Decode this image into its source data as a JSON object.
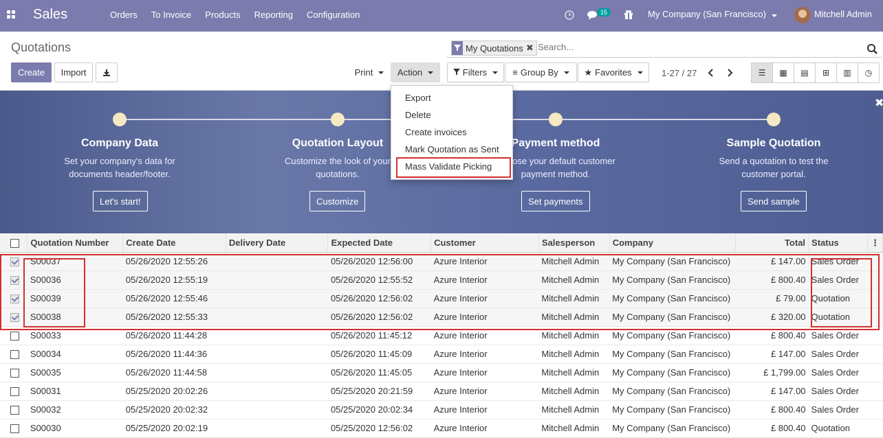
{
  "navbar": {
    "brand": "Sales",
    "menu": [
      "Orders",
      "To Invoice",
      "Products",
      "Reporting",
      "Configuration"
    ],
    "message_count": "15",
    "company": "My Company (San Francisco)",
    "user": "Mitchell Admin"
  },
  "control": {
    "title": "Quotations",
    "create": "Create",
    "import": "Import",
    "print": "Print",
    "action": "Action",
    "filters": "Filters",
    "group_by": "Group By",
    "favorites": "Favorites",
    "pager": "1-27 / 27",
    "facet": "My Quotations",
    "search_placeholder": "Search..."
  },
  "action_menu": [
    "Export",
    "Delete",
    "Create invoices",
    "Mark Quotation as Sent",
    "Mass Validate Picking"
  ],
  "onboarding": [
    {
      "title": "Company Data",
      "desc": "Set your company's data for documents header/footer.",
      "button": "Let's start!"
    },
    {
      "title": "Quotation Layout",
      "desc": "Customize the look of your quotations.",
      "button": "Customize"
    },
    {
      "title": "Payment method",
      "desc": "Choose your default customer payment method.",
      "button": "Set payments"
    },
    {
      "title": "Sample Quotation",
      "desc": "Send a quotation to test the customer portal.",
      "button": "Send sample"
    }
  ],
  "table": {
    "columns": [
      "Quotation Number",
      "Create Date",
      "Delivery Date",
      "Expected Date",
      "Customer",
      "Salesperson",
      "Company",
      "Total",
      "Status"
    ],
    "rows": [
      {
        "num": "S00037",
        "create": "05/26/2020 12:55:26",
        "delivery": "",
        "expected": "05/26/2020 12:56:00",
        "customer": "Azure Interior",
        "sales": "Mitchell Admin",
        "company": "My Company (San Francisco)",
        "total": "£ 147.00",
        "status": "Sales Order",
        "checked": true
      },
      {
        "num": "S00036",
        "create": "05/26/2020 12:55:19",
        "delivery": "",
        "expected": "05/26/2020 12:55:52",
        "customer": "Azure Interior",
        "sales": "Mitchell Admin",
        "company": "My Company (San Francisco)",
        "total": "£ 800.40",
        "status": "Sales Order",
        "checked": true
      },
      {
        "num": "S00039",
        "create": "05/26/2020 12:55:46",
        "delivery": "",
        "expected": "05/26/2020 12:56:02",
        "customer": "Azure Interior",
        "sales": "Mitchell Admin",
        "company": "My Company (San Francisco)",
        "total": "£ 79.00",
        "status": "Quotation",
        "checked": true
      },
      {
        "num": "S00038",
        "create": "05/26/2020 12:55:33",
        "delivery": "",
        "expected": "05/26/2020 12:56:02",
        "customer": "Azure Interior",
        "sales": "Mitchell Admin",
        "company": "My Company (San Francisco)",
        "total": "£ 320.00",
        "status": "Quotation",
        "checked": true
      },
      {
        "num": "S00033",
        "create": "05/26/2020 11:44:28",
        "delivery": "",
        "expected": "05/26/2020 11:45:12",
        "customer": "Azure Interior",
        "sales": "Mitchell Admin",
        "company": "My Company (San Francisco)",
        "total": "£ 800.40",
        "status": "Sales Order",
        "checked": false
      },
      {
        "num": "S00034",
        "create": "05/26/2020 11:44:36",
        "delivery": "",
        "expected": "05/26/2020 11:45:09",
        "customer": "Azure Interior",
        "sales": "Mitchell Admin",
        "company": "My Company (San Francisco)",
        "total": "£ 147.00",
        "status": "Sales Order",
        "checked": false
      },
      {
        "num": "S00035",
        "create": "05/26/2020 11:44:58",
        "delivery": "",
        "expected": "05/26/2020 11:45:05",
        "customer": "Azure Interior",
        "sales": "Mitchell Admin",
        "company": "My Company (San Francisco)",
        "total": "£ 1,799.00",
        "status": "Sales Order",
        "checked": false
      },
      {
        "num": "S00031",
        "create": "05/25/2020 20:02:26",
        "delivery": "",
        "expected": "05/25/2020 20:21:59",
        "customer": "Azure Interior",
        "sales": "Mitchell Admin",
        "company": "My Company (San Francisco)",
        "total": "£ 147.00",
        "status": "Sales Order",
        "checked": false
      },
      {
        "num": "S00032",
        "create": "05/25/2020 20:02:32",
        "delivery": "",
        "expected": "05/25/2020 20:02:34",
        "customer": "Azure Interior",
        "sales": "Mitchell Admin",
        "company": "My Company (San Francisco)",
        "total": "£ 800.40",
        "status": "Sales Order",
        "checked": false
      },
      {
        "num": "S00030",
        "create": "05/25/2020 20:02:19",
        "delivery": "",
        "expected": "05/25/2020 12:56:02",
        "customer": "Azure Interior",
        "sales": "Mitchell Admin",
        "company": "My Company (San Francisco)",
        "total": "£ 800.40",
        "status": "Quotation",
        "checked": false
      }
    ]
  }
}
